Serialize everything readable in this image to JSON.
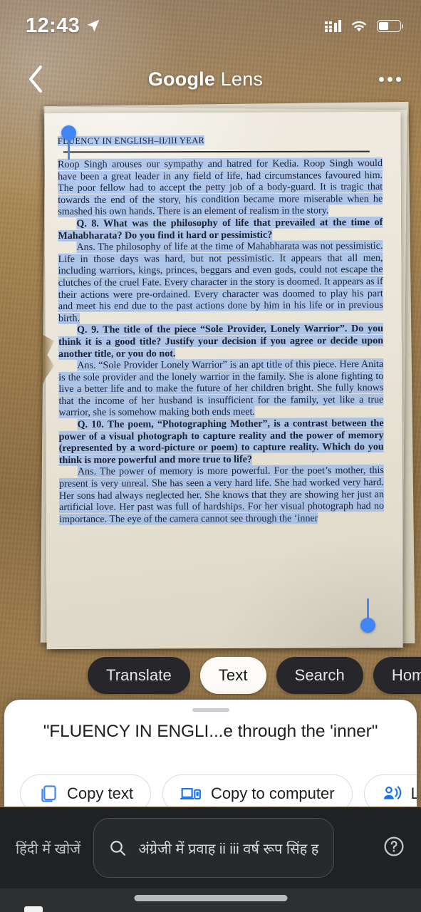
{
  "status_bar": {
    "time": "12:43",
    "location_icon": "location-arrow-icon",
    "signal_icon": "cellular-signal-icon",
    "wifi_icon": "wifi-icon",
    "battery_icon": "battery-icon"
  },
  "header": {
    "back_icon": "back-chevron-icon",
    "title_brand": "Google",
    "title_product": " Lens",
    "overflow_icon": "more-options-icon"
  },
  "document": {
    "running_head": "FLUENCY IN ENGLISH–II/III YEAR",
    "paragraphs": [
      {
        "id": "p1",
        "text": "Roop Singh arouses our sympathy and hatred for Kedia. Roop Singh would have been a great leader in any field of life, had circumstances favoured him. The poor fellow had to accept the petty job of a body-guard. It is tragic that towards the end of the story, his condition became more miserable when he smashed his own hands. There is an element of realism in the story."
      },
      {
        "id": "q8",
        "label": "Q. 8.",
        "text": "Q. 8.  What was the philosophy of life that prevailed at the time of Mahabharata? Do you find it hard or pessimistic?"
      },
      {
        "id": "a8",
        "lead": "Ans.",
        "text": "Ans. The philosophy of life at the time of Mahabharata was not pessimistic. Life in those days was hard, but not pessimistic. It appears that all men, including warriors, kings, princes, beggars and even gods, could not escape the clutches of the cruel Fate. Every character in the story is doomed. It appears as if their actions were pre-ordained. Every character was doomed to play his part and meet his end due to the past actions done by him in his life or in previous birth."
      },
      {
        "id": "q9",
        "label": "Q. 9.",
        "text": "Q. 9.  The title of the piece “Sole Provider, Lonely Warrior”. Do you think it is a good title? Justify your decision if you agree or decide upon another title, or you do not."
      },
      {
        "id": "a9",
        "lead": "Ans.",
        "text": "Ans. “Sole Provider Lonely Warrior” is an apt title of this piece. Here Anita is the sole provider and the lonely warrior in the family. She is alone fighting to live a better life and to make the future of her children bright. She fully knows that the income of her husband is insufficient for the family, yet like a true warrior, she is somehow making both ends meet."
      },
      {
        "id": "q10",
        "label": "Q. 10.",
        "text": "Q. 10.  The poem, “Photographing Mother”, is a contrast between the power of a visual photograph to capture reality and the power of memory (represented by a word-picture or poem) to capture reality. Which do you think is more powerful and more true to life?"
      },
      {
        "id": "a10",
        "lead": "Ans.",
        "text": "Ans. The power of memory is more powerful. For the poet’s mother, this present is very unreal. She has seen a very hard life. She had worked very hard. Her sons had always neglected her. She knows that they are showing her just an artificial love. Her past was full of hardships. For her visual photograph had no importance. The eye of the camera cannot see through the ‘inner"
      }
    ],
    "selection_handle_start": "selection-handle-start",
    "selection_handle_end": "selection-handle-end"
  },
  "mode_chips": [
    {
      "label": "Translate",
      "active": false
    },
    {
      "label": "Text",
      "active": true
    },
    {
      "label": "Search",
      "active": false
    },
    {
      "label": "Homework",
      "active": false
    }
  ],
  "bottom_sheet": {
    "selected_text_preview": "\"FLUENCY IN ENGLI...e through the 'inner\"",
    "actions": [
      {
        "label": "Copy text",
        "icon": "copy-icon"
      },
      {
        "label": "Copy to computer",
        "icon": "devices-icon"
      },
      {
        "label": "Listen",
        "icon": "listen-icon"
      }
    ]
  },
  "keyboard_bar": {
    "language_hint": "हिंदी में खोजें",
    "search_icon": "search-icon",
    "search_value": "अंग्रेजी में प्रवाह ii iii वर्ष रूप सिंह ह...",
    "help_icon": "help-icon"
  },
  "colors": {
    "accent_blue": "#4285f4",
    "selection_highlight": "#87b0f0",
    "chip_dark": "#27262a",
    "chip_active": "#fdfbf7",
    "sheet_white": "#ffffff",
    "keyboard_dark": "#1f2124"
  }
}
